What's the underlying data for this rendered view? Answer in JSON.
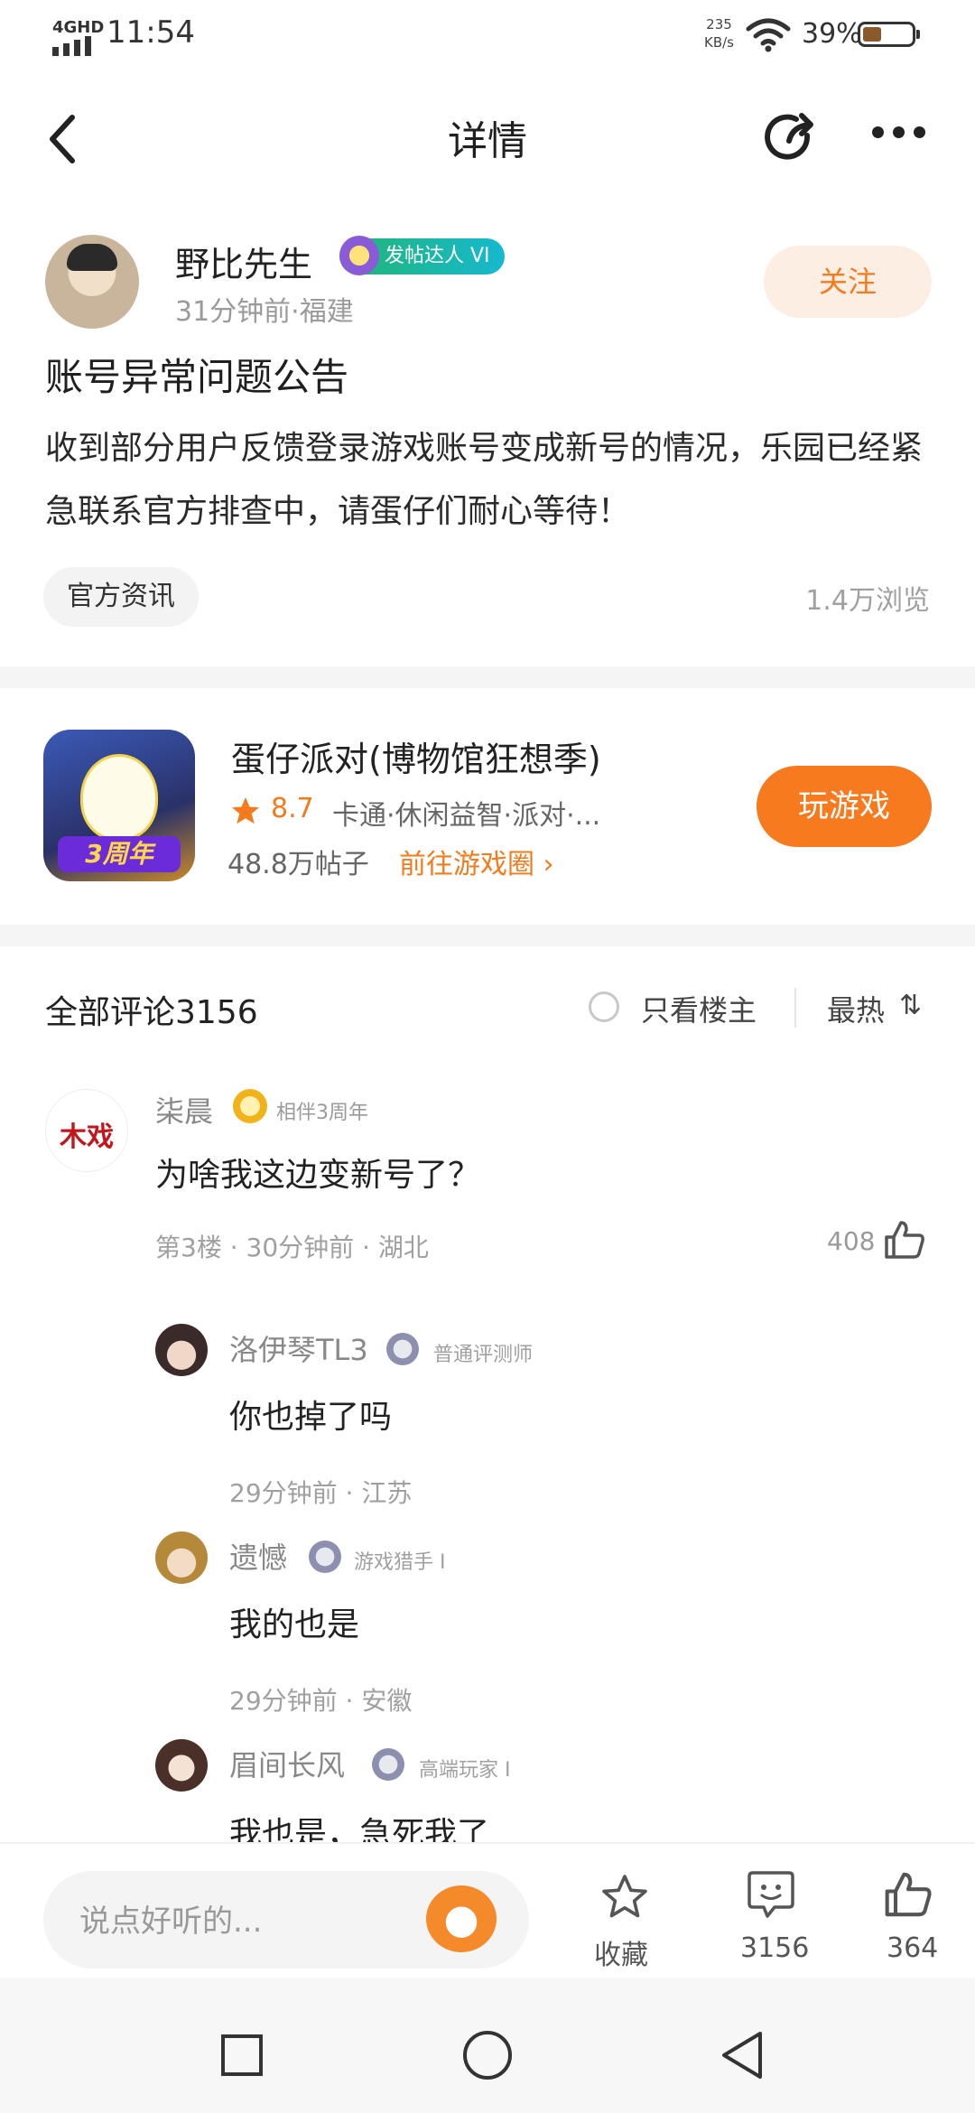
{
  "status_bar": {
    "network": "4GHD",
    "time": "11:54",
    "speed_value": "235",
    "speed_unit": "KB/s",
    "battery": "39%"
  },
  "header": {
    "title": "详情",
    "back_icon": "chevron-left-icon",
    "share_icon": "share-icon",
    "more_icon": "more-icon"
  },
  "post": {
    "author": "野比先生",
    "author_badge": "发帖达人 VI",
    "meta": "31分钟前·福建",
    "follow_label": "关注",
    "title": "账号异常问题公告",
    "body": "收到部分用户反馈登录游戏账号变成新号的情况，乐园已经紧急联系官方排查中，请蛋仔们耐心等待！",
    "tag": "官方资讯",
    "views": "1.4万浏览"
  },
  "game": {
    "icon_text": "3周年",
    "name": "蛋仔派对(博物馆狂想季)",
    "score": "8.7",
    "tags": "卡通·休闲益智·派对·...",
    "posts": "48.8万帖子",
    "goto": "前往游戏圈 ›",
    "play_label": "玩游戏"
  },
  "comments_header": {
    "title": "全部评论3156",
    "only_author": "只看楼主",
    "sort": "最热",
    "sort_icon": "⇅"
  },
  "comment": {
    "avatar_text": "木戏",
    "name": "柒晨",
    "badge": "相伴3周年",
    "text": "为啥我这边变新号了？",
    "meta": "第3楼 · 30分钟前 · 湖北",
    "likes": "408"
  },
  "replies": [
    {
      "name": "洛伊琴TL3",
      "badge": "普通评测师",
      "text": "你也掉了吗",
      "meta": "29分钟前 · 江苏"
    },
    {
      "name": "遗憾",
      "badge": "游戏猎手 I",
      "text": "我的也是",
      "meta": "29分钟前 · 安徽"
    },
    {
      "name": "眉间长风",
      "badge": "高端玩家 I",
      "text": "我也是，急死我了",
      "meta": ""
    }
  ],
  "bottom_bar": {
    "input_placeholder": "说点好听的...",
    "favorite_label": "收藏",
    "comment_count": "3156",
    "like_count": "364"
  },
  "colors": {
    "accent": "#f77a1f",
    "follow_bg": "#fdeee3",
    "badge_green": "#22b573"
  }
}
